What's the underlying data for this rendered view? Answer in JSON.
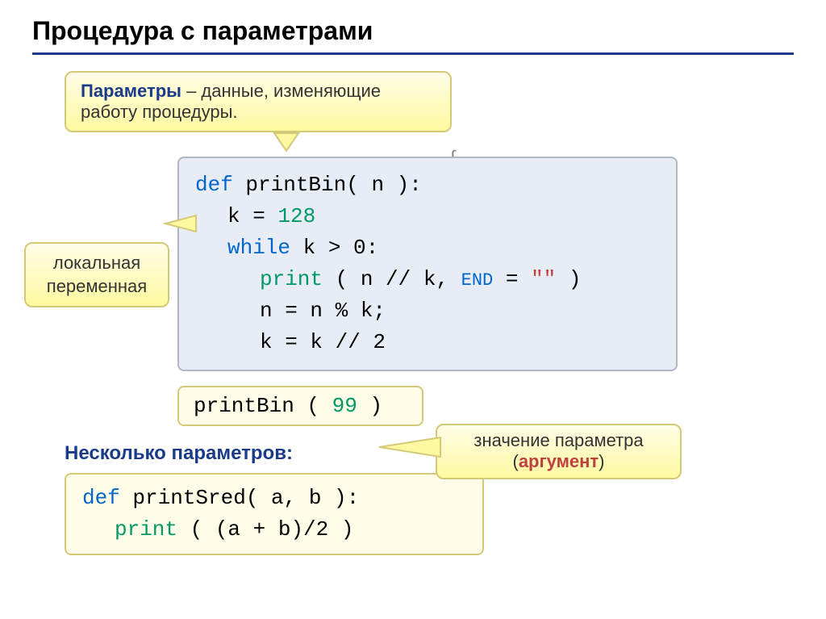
{
  "title": "Процедура с параметрами",
  "callouts": {
    "params_def_prefix": "Параметры",
    "params_def_rest": " – данные, изменяющие работу процедуры.",
    "local_var": "локальная переменная",
    "arg_line1": "значение параметра",
    "arg_line2_open": "(",
    "arg_line2_word": "аргумент",
    "arg_line2_close": ")"
  },
  "code": {
    "line1_def": "def",
    "line1_rest": " printBin( n ):",
    "line2_k": "k = ",
    "line2_num": "128",
    "line3_while": "while",
    "line3_rest": " k > 0:",
    "line4_print": "print",
    "line4_mid": " ( n // k, ",
    "line4_end_kw": "end",
    "line4_eq": " = ",
    "line4_str": "\"\"",
    "line4_close": " )",
    "line5": "n = n % k;",
    "line6": "k = k // 2",
    "call_name": "printBin ( ",
    "call_num": "99",
    "call_close": " )"
  },
  "multi": {
    "subtitle": "Несколько параметров:",
    "line1_def": "def",
    "line1_rest": " printSred( a, b ):",
    "line2_print": "print",
    "line2_rest": " ( (a + b)/2 )"
  }
}
